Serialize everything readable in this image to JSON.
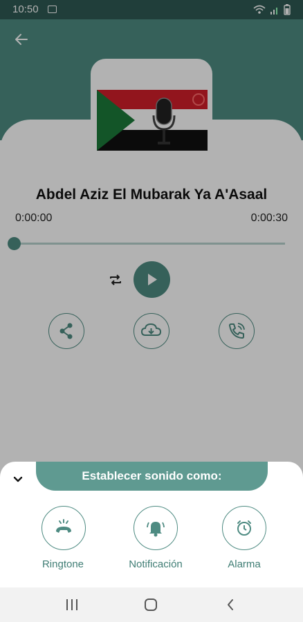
{
  "status_bar": {
    "time": "10:50",
    "icons": [
      "image-icon",
      "wifi-icon",
      "signal-icon",
      "battery-icon"
    ]
  },
  "header": {
    "back_icon": "arrow-left-icon"
  },
  "player": {
    "title": "Abdel Aziz El Mubarak  Ya A'Asaal",
    "current_time": "0:00:00",
    "total_time": "0:00:30",
    "progress": 0.0
  },
  "controls": {
    "repeat_icon": "repeat-icon",
    "play_icon": "play-icon",
    "share_icon": "share-icon",
    "download_icon": "cloud-download-icon",
    "call_icon": "phone-call-icon"
  },
  "sheet": {
    "title": "Establecer sonido como:",
    "options": [
      {
        "label": "Ringtone",
        "icon": "ringing-phone-icon"
      },
      {
        "label": "Notificación",
        "icon": "bell-icon"
      },
      {
        "label": "Alarma",
        "icon": "alarm-clock-icon"
      }
    ]
  },
  "colors": {
    "accent": "#4e8b82",
    "header_bg": "#4e8b82",
    "status_bg": "#2f5a54",
    "pill_bg": "#5f9a91"
  }
}
